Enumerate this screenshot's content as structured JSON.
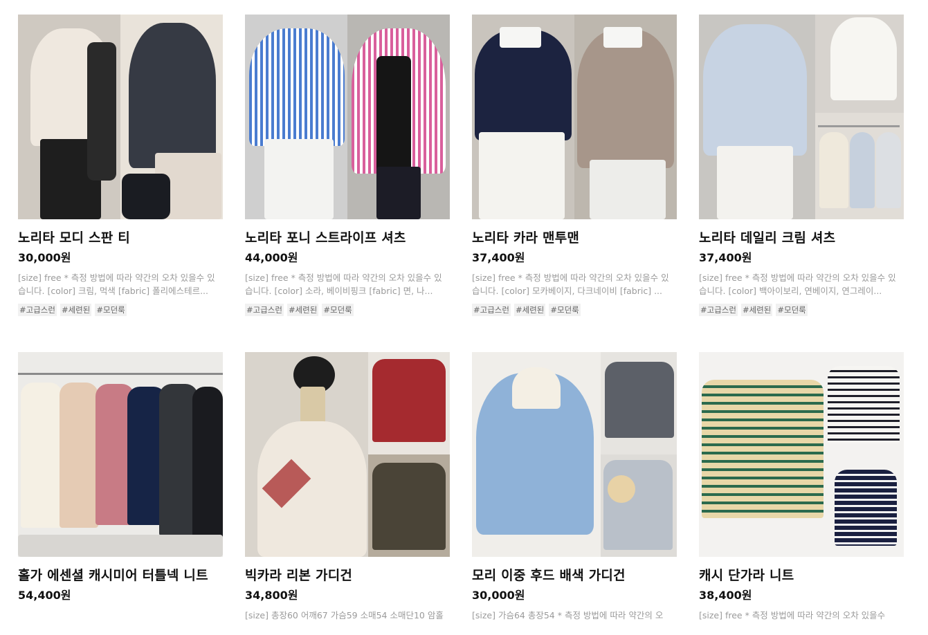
{
  "currency_suffix": "원",
  "products": [
    {
      "title": "노리타 모디 스판 티",
      "price": "30,000",
      "desc": "[size] free * 측정 방법에 따라 약간의 오차 있을수 있습니다. [color] 크림, 먹색 [fabric] 폴리에스테르...",
      "tags": [
        "#고급스런",
        "#세련된",
        "#모던룩"
      ]
    },
    {
      "title": "노리타 포니 스트라이프 셔츠",
      "price": "44,000",
      "desc": "[size] free * 측정 방법에 따라 약간의 오차 있을수 있습니다. [color] 소라, 베이비핑크 [fabric] 면, 나...",
      "tags": [
        "#고급스런",
        "#세련된",
        "#모던룩"
      ]
    },
    {
      "title": "노리타 카라 맨투맨",
      "price": "37,400",
      "desc": "[size] free * 측정 방법에 따라 약간의 오차 있을수 있습니다. [color] 모카베이지, 다크네이비 [fabric] ...",
      "tags": [
        "#고급스런",
        "#세련된",
        "#모던룩"
      ]
    },
    {
      "title": "노리타 데일리 크림 셔츠",
      "price": "37,400",
      "desc": "[size] free * 측정 방법에 따라 약간의 오차 있을수 있습니다. [color] 백아이보리, 연베이지, 연그레이...",
      "tags": [
        "#고급스런",
        "#세련된",
        "#모던룩"
      ]
    },
    {
      "title": "홀가 에센셜 캐시미어 터틀넥 니트",
      "price": "54,400",
      "desc": "",
      "tags": []
    },
    {
      "title": "빅카라 리본 가디건",
      "price": "34,800",
      "desc": "[size] 총장60 어깨67 가슴59 소매54 소매단10 암홀",
      "tags": []
    },
    {
      "title": "모리 이중 후드 배색 가디건",
      "price": "30,000",
      "desc": "[size] 가슴64 총장54 * 측정 방법에 따라 약간의 오",
      "tags": []
    },
    {
      "title": "캐시 단가라 니트",
      "price": "38,400",
      "desc": "[size] free * 측정 방법에 따라 약간의 오차 있을수",
      "tags": []
    }
  ]
}
